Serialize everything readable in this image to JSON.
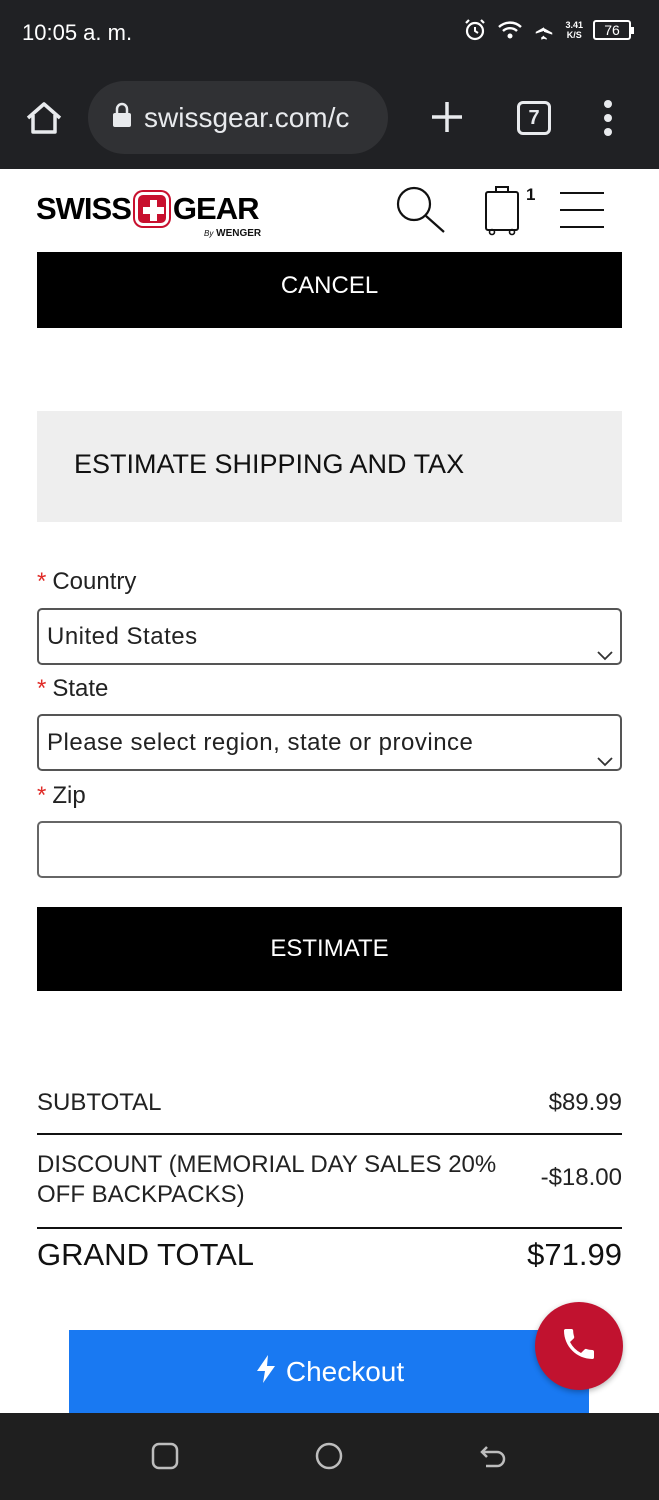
{
  "status_bar": {
    "time": "10:05 a. m.",
    "net_speed_value": "3.41",
    "net_speed_unit": "K/S",
    "battery": "76"
  },
  "browser": {
    "url": "swissgear.com/c",
    "tab_count": "7"
  },
  "site_header": {
    "logo_left": "SWISS",
    "logo_right": "GEAR",
    "logo_by": "By",
    "logo_brand": "WENGER",
    "cart_count": "1"
  },
  "cancel_label": "CANCEL",
  "estimate": {
    "title": "ESTIMATE SHIPPING AND TAX",
    "country_label": "Country",
    "country_value": "United States",
    "state_label": "State",
    "state_value": "Please select region, state or province",
    "zip_label": "Zip",
    "zip_value": "",
    "required_mark": "*",
    "button_label": "ESTIMATE"
  },
  "totals": {
    "subtotal_label": "SUBTOTAL",
    "subtotal_value": "$89.99",
    "discount_label_line1": "DISCOUNT (MEMORIAL DAY SALES 20%",
    "discount_label_line2": "OFF BACKPACKS)",
    "discount_value": "-$18.00",
    "grand_total_label": "GRAND TOTAL",
    "grand_total_value": "$71.99"
  },
  "checkout_label": "Checkout",
  "colors": {
    "checkout_blue": "#1979f2",
    "call_red": "#c1122f",
    "required_red": "#e02b27"
  }
}
